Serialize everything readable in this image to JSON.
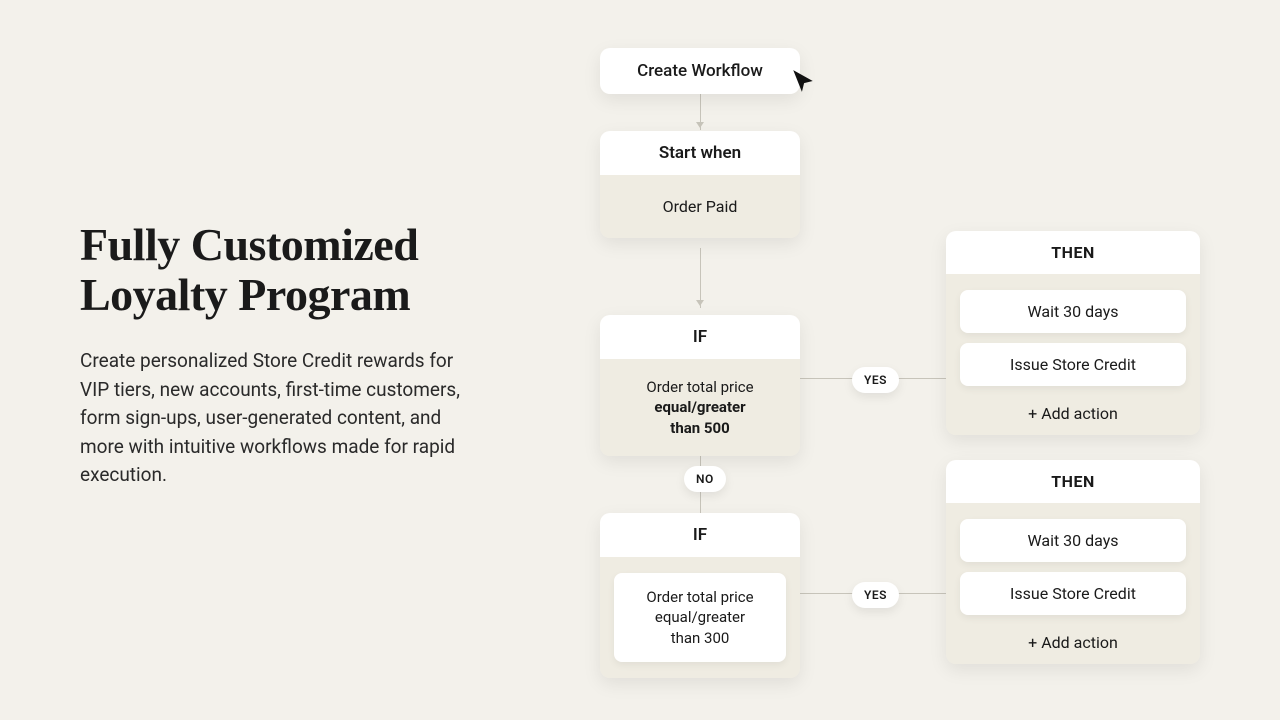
{
  "hero": {
    "title": "Fully Customized Loyalty Program",
    "body": "Create personalized Store Credit rewards for VIP tiers, new accounts, first-time customers, form sign-ups, user-generated content, and more with intuitive workflows made for rapid execution."
  },
  "workflow": {
    "create_label": "Create Workflow",
    "start": {
      "head": "Start when",
      "trigger": "Order Paid"
    },
    "if1": {
      "head": "IF",
      "line1": "Order total price",
      "line2": "equal/greater",
      "line3": "than 500"
    },
    "if2": {
      "head": "IF",
      "line1": "Order total price",
      "line2": "equal/greater",
      "line3": "than 300"
    },
    "labels": {
      "yes": "YES",
      "no": "NO"
    },
    "then1": {
      "head": "THEN",
      "action1": "Wait 30 days",
      "action2": "Issue Store Credit",
      "add": "+ Add action"
    },
    "then2": {
      "head": "THEN",
      "action1": "Wait 30 days",
      "action2": "Issue Store Credit",
      "add": "+ Add action"
    }
  }
}
